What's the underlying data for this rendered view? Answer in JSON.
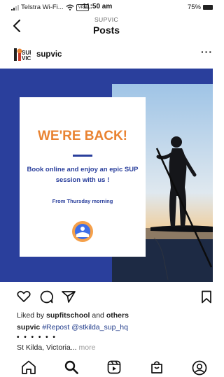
{
  "status_bar": {
    "carrier": "Telstra Wi-Fi...",
    "vpn": "VPN",
    "time": "11:50 am",
    "battery": "75%",
    "icons": [
      "signal-icon",
      "wifi-icon",
      "battery-icon"
    ]
  },
  "nav": {
    "account": "SUPVIC",
    "title": "Posts",
    "back_icon": "chevron-left-icon"
  },
  "post": {
    "username": "supvic",
    "avatar_icon": "supvic-logo",
    "more_icon": "ellipsis-icon",
    "image": {
      "headline": "WE'RE BACK!",
      "description": "Book online and enjoy an epic SUP session with us !",
      "from": "From Thursday morning",
      "colors": {
        "background": "#2a3f9c",
        "headline": "#e98332",
        "text": "#2a3f9c"
      }
    },
    "actions": [
      "heart-icon",
      "comment-icon",
      "share-icon",
      "bookmark-icon"
    ],
    "liked_prefix": "Liked by ",
    "liked_user": "supfitschool",
    "liked_and": " and ",
    "liked_others": "others",
    "caption_user": "supvic",
    "caption_tag": "#Repost @stkilda_sup_hq",
    "caption_dots": "• • • • • •",
    "location": "St Kilda, Victoria...",
    "more_label": "more"
  },
  "tabbar": {
    "icons": [
      "home-icon",
      "search-icon",
      "reels-icon",
      "shop-icon",
      "profile-icon"
    ]
  }
}
